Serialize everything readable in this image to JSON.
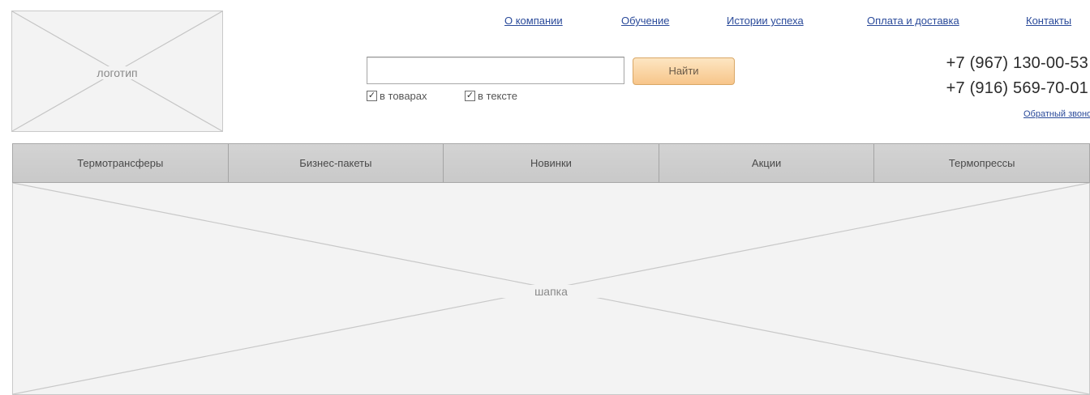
{
  "logo": {
    "label": "логотип"
  },
  "top_nav": [
    {
      "label": "О компании"
    },
    {
      "label": "Обучение"
    },
    {
      "label": "Истории успеха"
    },
    {
      "label": "Оплата и доставка"
    },
    {
      "label": "Контакты"
    }
  ],
  "search": {
    "value": "",
    "button_label": "Найти",
    "options": [
      {
        "label": "в товарах",
        "checked": true
      },
      {
        "label": "в тексте",
        "checked": true
      }
    ]
  },
  "contacts": {
    "phones": [
      "+7 (967) 130-00-53",
      "+7 (916) 569-70-01"
    ],
    "callback_label": "Обратный звонок"
  },
  "menu": [
    {
      "label": "Термотрансферы"
    },
    {
      "label": "Бизнес-пакеты"
    },
    {
      "label": "Новинки"
    },
    {
      "label": "Акции"
    },
    {
      "label": "Термопрессы"
    }
  ],
  "banner": {
    "label": "шапка"
  },
  "colors": {
    "link": "#2a4a9a",
    "menu_bg": "#cfcfcf",
    "placeholder_bg": "#f3f3f3",
    "button_bg": "#f7c58a"
  }
}
